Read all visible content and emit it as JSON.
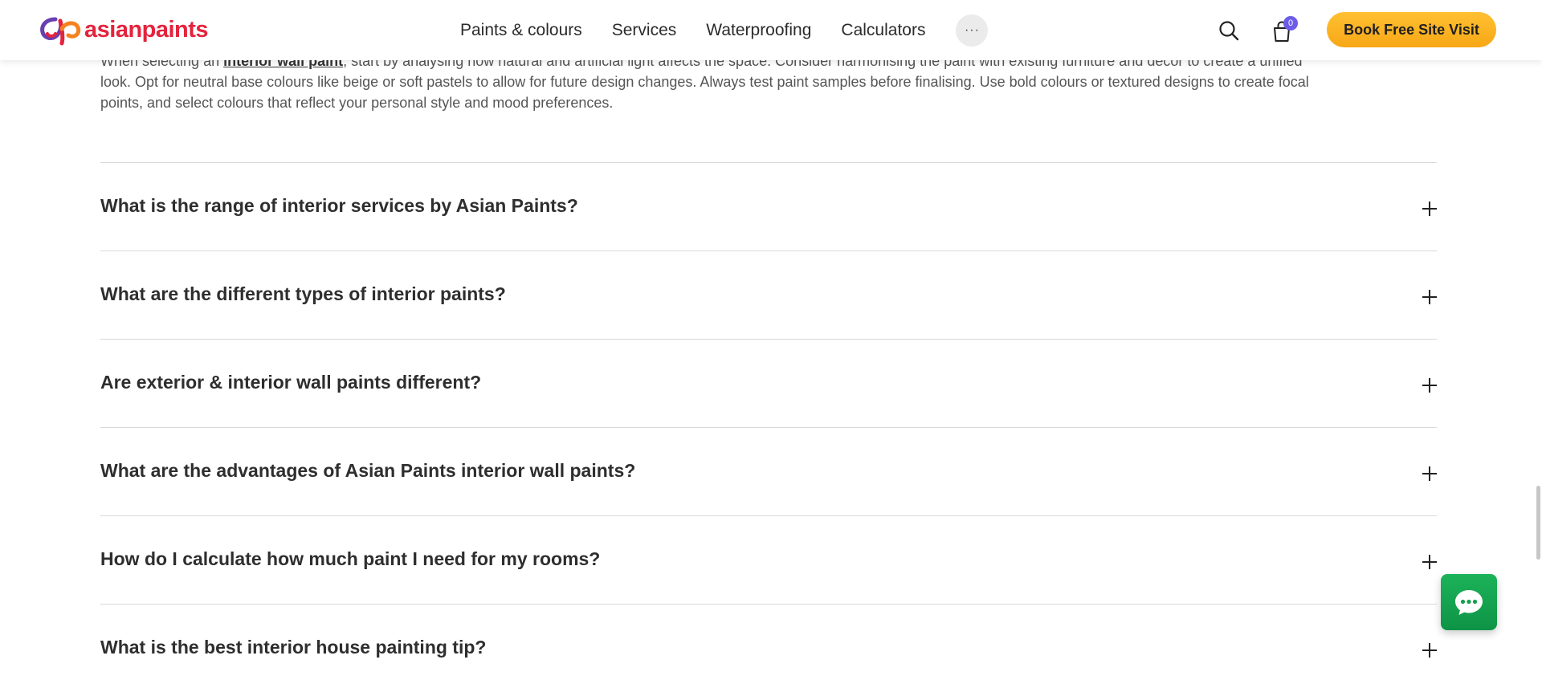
{
  "header": {
    "logo_text": "asianpaints",
    "nav": [
      "Paints & colours",
      "Services",
      "Waterproofing",
      "Calculators"
    ],
    "more_label": "···",
    "cart_count": "0",
    "cta_label": "Book Free Site Visit",
    "accent_color": "#f7a716",
    "brand_color": "#e4233d"
  },
  "intro": {
    "prefix": "When selecting an ",
    "link_text": "interior wall paint",
    "suffix": ", start by analysing how natural and artificial light affects the space. Consider harmonising the paint with existing furniture and decor to create a unified look. Opt for neutral base colours like beige or soft pastels to allow for future design changes. Always test paint samples before finalising. Use bold colours or textured designs to create focal points, and select colours that reflect your personal style and mood preferences."
  },
  "faq": [
    "What is the range of interior services by Asian Paints?",
    "What are the different types of interior paints?",
    "Are exterior & interior wall paints different?",
    "What are the advantages of Asian Paints interior wall paints?",
    "How do I calculate how much paint I need for my rooms?",
    "What is the best interior house painting tip?"
  ],
  "icons": {
    "search": "search-icon",
    "cart": "shopping-bag-icon",
    "expand": "plus-icon",
    "chat": "chat-bubble-icon"
  }
}
